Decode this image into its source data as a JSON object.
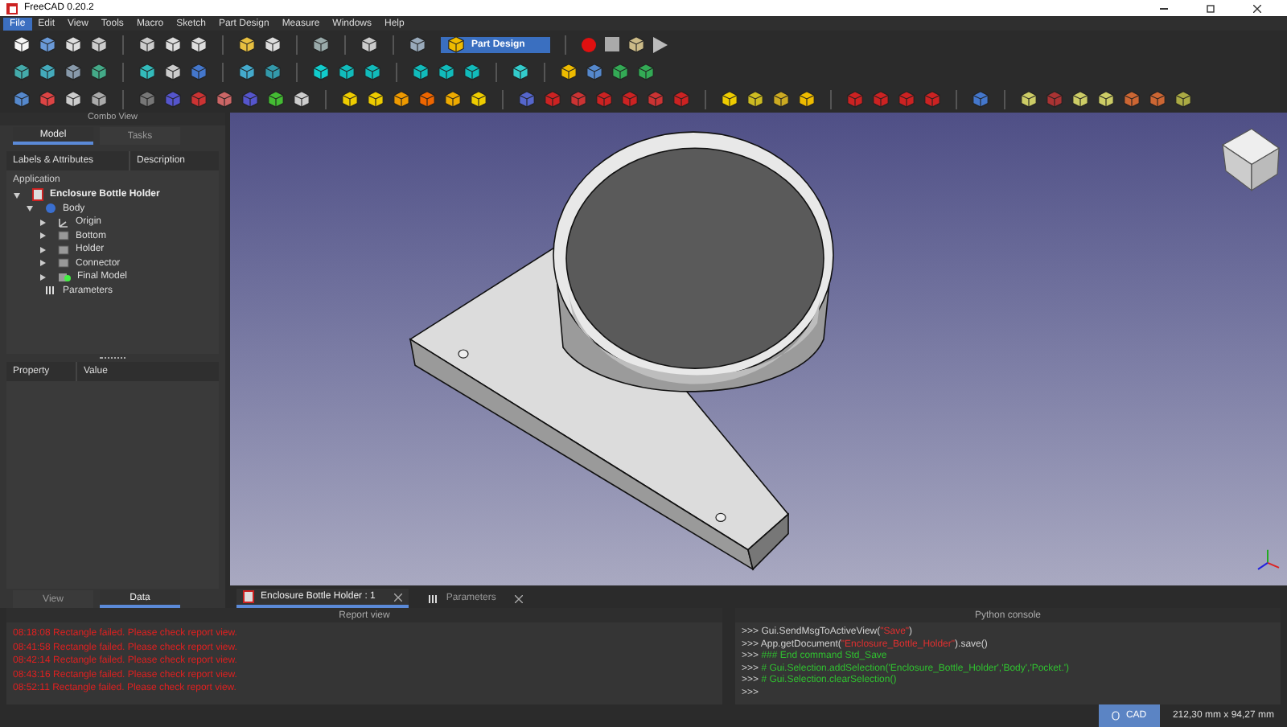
{
  "window": {
    "title": "FreeCAD 0.20.2"
  },
  "menu": [
    {
      "label": "File",
      "selected": true
    },
    {
      "label": "Edit",
      "selected": false
    },
    {
      "label": "View",
      "selected": false
    },
    {
      "label": "Tools",
      "selected": false
    },
    {
      "label": "Macro",
      "selected": false
    },
    {
      "label": "Sketch",
      "selected": false
    },
    {
      "label": "Part Design",
      "selected": false
    },
    {
      "label": "Measure",
      "selected": false
    },
    {
      "label": "Windows",
      "selected": false
    },
    {
      "label": "Help",
      "selected": false
    }
  ],
  "workbench": {
    "value": "Part Design"
  },
  "combo_view": {
    "title": "Combo View",
    "tabs": [
      {
        "label": "Model",
        "selected": true
      },
      {
        "label": "Tasks",
        "selected": false
      }
    ],
    "columns": [
      "Labels & Attributes",
      "Description"
    ],
    "tree": {
      "label": "Application",
      "children": [
        {
          "label": "Enclosure Bottle Holder",
          "kind": "document",
          "expanded": true,
          "children": [
            {
              "label": "Body",
              "kind": "body",
              "expanded": true,
              "children": [
                {
                  "label": "Origin",
                  "kind": "origin",
                  "expanded": false
                },
                {
                  "label": "Bottom",
                  "kind": "feature",
                  "expanded": false
                },
                {
                  "label": "Holder",
                  "kind": "feature",
                  "expanded": false
                },
                {
                  "label": "Connector",
                  "kind": "feature",
                  "expanded": false
                },
                {
                  "label": "Final Model",
                  "kind": "tip",
                  "expanded": false
                }
              ]
            },
            {
              "label": "Parameters",
              "kind": "spreadsheet"
            }
          ]
        }
      ]
    }
  },
  "property_view": {
    "columns": [
      "Property",
      "Value"
    ],
    "tabs": [
      {
        "label": "View",
        "selected": false
      },
      {
        "label": "Data",
        "selected": true
      }
    ]
  },
  "document_tabs": [
    {
      "label": "Enclosure Bottle Holder : 1",
      "kind": "document",
      "selected": true
    },
    {
      "label": "Parameters",
      "kind": "spreadsheet",
      "selected": false
    }
  ],
  "report_view": {
    "title": "Report view",
    "lines": [
      {
        "text": "08:18:08  Rectangle failed. Please check report view.",
        "kind": "error"
      },
      {
        "text": "08:41:58  Rectangle failed. Please check report view.",
        "kind": "error"
      },
      {
        "text": "08:42:14  Rectangle failed. Please check report view.",
        "kind": "error"
      },
      {
        "text": "08:43:16  Rectangle failed. Please check report view.",
        "kind": "error"
      },
      {
        "text": "08:52:11  Rectangle failed. Please check report view.",
        "kind": "error"
      }
    ]
  },
  "python_console": {
    "title": "Python console",
    "lines": [
      [
        {
          "text": ">>> ",
          "kind": "code"
        },
        {
          "text": "Gui.SendMsgToActiveView(",
          "kind": "code"
        },
        {
          "text": "\"Save\"",
          "kind": "string"
        },
        {
          "text": ")",
          "kind": "code"
        }
      ],
      [
        {
          "text": ">>> ",
          "kind": "code"
        },
        {
          "text": "App.getDocument(",
          "kind": "code"
        },
        {
          "text": "\"Enclosure_Bottle_Holder\"",
          "kind": "string"
        },
        {
          "text": ").save()",
          "kind": "code"
        }
      ],
      [
        {
          "text": ">>> ",
          "kind": "code"
        },
        {
          "text": "### End command Std_Save",
          "kind": "comment"
        }
      ],
      [
        {
          "text": ">>> ",
          "kind": "code"
        },
        {
          "text": "# Gui.Selection.addSelection('Enclosure_Bottle_Holder','Body','Pocket.')",
          "kind": "comment"
        }
      ],
      [
        {
          "text": ">>> ",
          "kind": "code"
        },
        {
          "text": "# Gui.Selection.clearSelection()",
          "kind": "comment"
        }
      ],
      [
        {
          "text": ">>>",
          "kind": "code"
        }
      ]
    ]
  },
  "status_bar": {
    "navigation": "CAD",
    "dimensions": "212,30 mm x 94,27 mm"
  }
}
